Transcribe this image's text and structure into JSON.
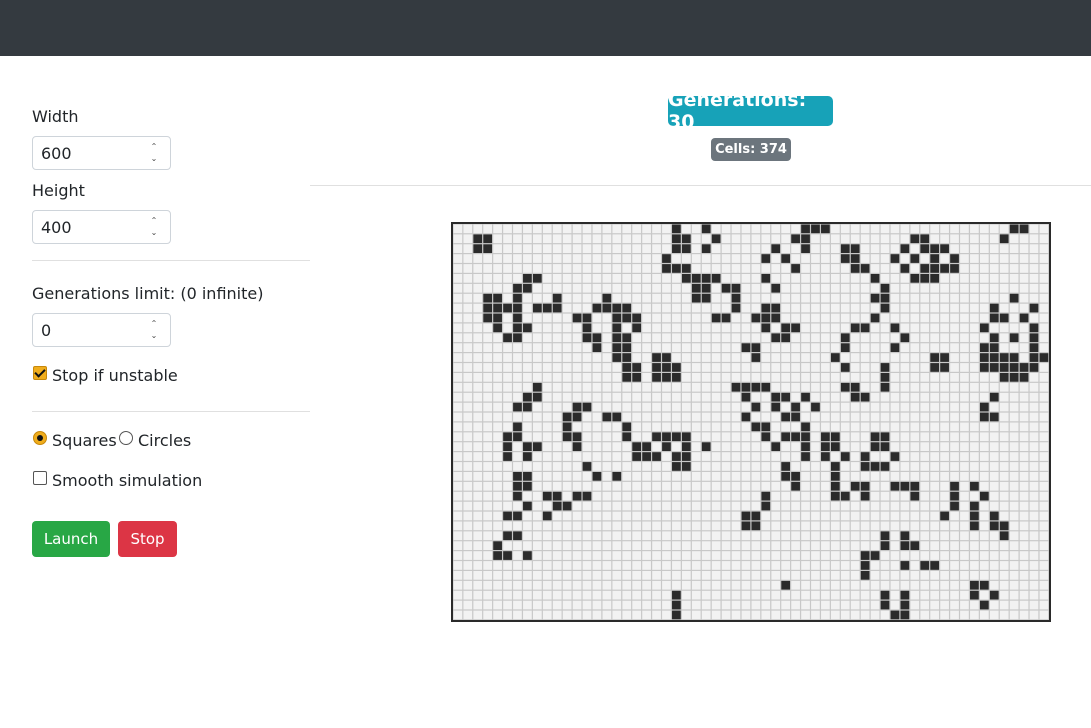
{
  "controls": {
    "width_label": "Width",
    "width_value": "600",
    "height_label": "Height",
    "height_value": "400",
    "gen_limit_label": "Generations limit: (0 infinite)",
    "gen_limit_value": "0",
    "stop_unstable_label": "Stop if unstable",
    "stop_unstable_checked": true,
    "shape_options": [
      "Squares",
      "Circles"
    ],
    "shape_selected": "Squares",
    "smooth_label": "Smooth simulation",
    "smooth_checked": false,
    "launch_label": "Launch",
    "stop_label": "Stop"
  },
  "stats": {
    "generations": "Generations: 30",
    "cells": "Cells: 374"
  },
  "colors": {
    "navbar": "#343a40",
    "launch": "#28a745",
    "stop": "#dc3545",
    "generations_badge": "#17a2b8",
    "cells_badge": "#6c757d",
    "accent": "#f0ad1c",
    "live_cell": "#2b2b2b",
    "dead_cell": "#f2f2f2"
  },
  "board": {
    "cols": 60,
    "rows": 40,
    "live_cells": [
      [
        0,
        22
      ],
      [
        0,
        25
      ],
      [
        0,
        35
      ],
      [
        0,
        36
      ],
      [
        0,
        37
      ],
      [
        0,
        56
      ],
      [
        0,
        57
      ],
      [
        1,
        2
      ],
      [
        1,
        3
      ],
      [
        1,
        22
      ],
      [
        1,
        23
      ],
      [
        1,
        26
      ],
      [
        1,
        34
      ],
      [
        1,
        35
      ],
      [
        1,
        46
      ],
      [
        1,
        47
      ],
      [
        1,
        55
      ],
      [
        2,
        2
      ],
      [
        2,
        3
      ],
      [
        2,
        22
      ],
      [
        2,
        23
      ],
      [
        2,
        25
      ],
      [
        2,
        32
      ],
      [
        2,
        35
      ],
      [
        2,
        39
      ],
      [
        2,
        40
      ],
      [
        2,
        45
      ],
      [
        2,
        47
      ],
      [
        2,
        48
      ],
      [
        2,
        49
      ],
      [
        3,
        21
      ],
      [
        3,
        31
      ],
      [
        3,
        33
      ],
      [
        3,
        39
      ],
      [
        3,
        40
      ],
      [
        3,
        44
      ],
      [
        3,
        46
      ],
      [
        3,
        48
      ],
      [
        3,
        50
      ],
      [
        4,
        21
      ],
      [
        4,
        22
      ],
      [
        4,
        23
      ],
      [
        4,
        34
      ],
      [
        4,
        40
      ],
      [
        4,
        41
      ],
      [
        4,
        45
      ],
      [
        4,
        47
      ],
      [
        4,
        48
      ],
      [
        4,
        49
      ],
      [
        4,
        50
      ],
      [
        5,
        7
      ],
      [
        5,
        8
      ],
      [
        5,
        23
      ],
      [
        5,
        24
      ],
      [
        5,
        25
      ],
      [
        5,
        26
      ],
      [
        5,
        31
      ],
      [
        5,
        42
      ],
      [
        5,
        46
      ],
      [
        5,
        47
      ],
      [
        5,
        48
      ],
      [
        6,
        6
      ],
      [
        6,
        7
      ],
      [
        6,
        24
      ],
      [
        6,
        25
      ],
      [
        6,
        27
      ],
      [
        6,
        28
      ],
      [
        6,
        32
      ],
      [
        6,
        43
      ],
      [
        7,
        3
      ],
      [
        7,
        4
      ],
      [
        7,
        6
      ],
      [
        7,
        10
      ],
      [
        7,
        15
      ],
      [
        7,
        24
      ],
      [
        7,
        25
      ],
      [
        7,
        28
      ],
      [
        7,
        42
      ],
      [
        7,
        43
      ],
      [
        7,
        56
      ],
      [
        8,
        3
      ],
      [
        8,
        4
      ],
      [
        8,
        5
      ],
      [
        8,
        6
      ],
      [
        8,
        8
      ],
      [
        8,
        9
      ],
      [
        8,
        10
      ],
      [
        8,
        14
      ],
      [
        8,
        15
      ],
      [
        8,
        16
      ],
      [
        8,
        17
      ],
      [
        8,
        28
      ],
      [
        8,
        31
      ],
      [
        8,
        32
      ],
      [
        8,
        43
      ],
      [
        8,
        54
      ],
      [
        8,
        58
      ],
      [
        9,
        3
      ],
      [
        9,
        4
      ],
      [
        9,
        6
      ],
      [
        9,
        12
      ],
      [
        9,
        13
      ],
      [
        9,
        16
      ],
      [
        9,
        17
      ],
      [
        9,
        18
      ],
      [
        9,
        26
      ],
      [
        9,
        27
      ],
      [
        9,
        30
      ],
      [
        9,
        31
      ],
      [
        9,
        32
      ],
      [
        9,
        42
      ],
      [
        9,
        54
      ],
      [
        9,
        55
      ],
      [
        9,
        57
      ],
      [
        10,
        4
      ],
      [
        10,
        6
      ],
      [
        10,
        7
      ],
      [
        10,
        13
      ],
      [
        10,
        16
      ],
      [
        10,
        18
      ],
      [
        10,
        31
      ],
      [
        10,
        33
      ],
      [
        10,
        34
      ],
      [
        10,
        40
      ],
      [
        10,
        41
      ],
      [
        10,
        44
      ],
      [
        10,
        53
      ],
      [
        10,
        58
      ],
      [
        11,
        5
      ],
      [
        11,
        6
      ],
      [
        11,
        13
      ],
      [
        11,
        14
      ],
      [
        11,
        16
      ],
      [
        11,
        17
      ],
      [
        11,
        32
      ],
      [
        11,
        33
      ],
      [
        11,
        39
      ],
      [
        11,
        45
      ],
      [
        11,
        54
      ],
      [
        11,
        56
      ],
      [
        11,
        58
      ],
      [
        12,
        14
      ],
      [
        12,
        16
      ],
      [
        12,
        17
      ],
      [
        12,
        29
      ],
      [
        12,
        30
      ],
      [
        12,
        39
      ],
      [
        12,
        44
      ],
      [
        12,
        53
      ],
      [
        12,
        54
      ],
      [
        12,
        58
      ],
      [
        13,
        16
      ],
      [
        13,
        17
      ],
      [
        13,
        20
      ],
      [
        13,
        21
      ],
      [
        13,
        30
      ],
      [
        13,
        38
      ],
      [
        13,
        48
      ],
      [
        13,
        49
      ],
      [
        13,
        53
      ],
      [
        13,
        54
      ],
      [
        13,
        55
      ],
      [
        13,
        56
      ],
      [
        13,
        58
      ],
      [
        13,
        59
      ],
      [
        14,
        17
      ],
      [
        14,
        18
      ],
      [
        14,
        20
      ],
      [
        14,
        21
      ],
      [
        14,
        22
      ],
      [
        14,
        39
      ],
      [
        14,
        43
      ],
      [
        14,
        48
      ],
      [
        14,
        49
      ],
      [
        14,
        53
      ],
      [
        14,
        54
      ],
      [
        14,
        55
      ],
      [
        14,
        56
      ],
      [
        14,
        57
      ],
      [
        14,
        58
      ],
      [
        15,
        17
      ],
      [
        15,
        18
      ],
      [
        15,
        20
      ],
      [
        15,
        21
      ],
      [
        15,
        22
      ],
      [
        15,
        43
      ],
      [
        15,
        55
      ],
      [
        15,
        56
      ],
      [
        15,
        57
      ],
      [
        16,
        8
      ],
      [
        16,
        28
      ],
      [
        16,
        29
      ],
      [
        16,
        30
      ],
      [
        16,
        31
      ],
      [
        16,
        39
      ],
      [
        16,
        40
      ],
      [
        16,
        43
      ],
      [
        17,
        7
      ],
      [
        17,
        8
      ],
      [
        17,
        29
      ],
      [
        17,
        32
      ],
      [
        17,
        33
      ],
      [
        17,
        35
      ],
      [
        17,
        40
      ],
      [
        17,
        41
      ],
      [
        17,
        54
      ],
      [
        18,
        6
      ],
      [
        18,
        7
      ],
      [
        18,
        12
      ],
      [
        18,
        13
      ],
      [
        18,
        30
      ],
      [
        18,
        32
      ],
      [
        18,
        34
      ],
      [
        18,
        36
      ],
      [
        18,
        53
      ],
      [
        19,
        11
      ],
      [
        19,
        12
      ],
      [
        19,
        15
      ],
      [
        19,
        16
      ],
      [
        19,
        29
      ],
      [
        19,
        33
      ],
      [
        19,
        34
      ],
      [
        19,
        53
      ],
      [
        19,
        54
      ],
      [
        20,
        6
      ],
      [
        20,
        11
      ],
      [
        20,
        17
      ],
      [
        20,
        30
      ],
      [
        20,
        31
      ],
      [
        20,
        35
      ],
      [
        21,
        5
      ],
      [
        21,
        6
      ],
      [
        21,
        11
      ],
      [
        21,
        12
      ],
      [
        21,
        17
      ],
      [
        21,
        20
      ],
      [
        21,
        21
      ],
      [
        21,
        22
      ],
      [
        21,
        23
      ],
      [
        21,
        31
      ],
      [
        21,
        33
      ],
      [
        21,
        34
      ],
      [
        21,
        35
      ],
      [
        21,
        37
      ],
      [
        21,
        38
      ],
      [
        21,
        42
      ],
      [
        21,
        43
      ],
      [
        22,
        5
      ],
      [
        22,
        7
      ],
      [
        22,
        8
      ],
      [
        22,
        12
      ],
      [
        22,
        18
      ],
      [
        22,
        19
      ],
      [
        22,
        21
      ],
      [
        22,
        23
      ],
      [
        22,
        25
      ],
      [
        22,
        32
      ],
      [
        22,
        35
      ],
      [
        22,
        37
      ],
      [
        22,
        38
      ],
      [
        22,
        42
      ],
      [
        22,
        43
      ],
      [
        23,
        5
      ],
      [
        23,
        7
      ],
      [
        23,
        18
      ],
      [
        23,
        19
      ],
      [
        23,
        20
      ],
      [
        23,
        22
      ],
      [
        23,
        23
      ],
      [
        23,
        35
      ],
      [
        23,
        37
      ],
      [
        23,
        39
      ],
      [
        23,
        41
      ],
      [
        23,
        44
      ],
      [
        24,
        13
      ],
      [
        24,
        22
      ],
      [
        24,
        23
      ],
      [
        24,
        33
      ],
      [
        24,
        38
      ],
      [
        24,
        41
      ],
      [
        24,
        42
      ],
      [
        24,
        43
      ],
      [
        25,
        6
      ],
      [
        25,
        7
      ],
      [
        25,
        14
      ],
      [
        25,
        16
      ],
      [
        25,
        33
      ],
      [
        25,
        34
      ],
      [
        25,
        38
      ],
      [
        26,
        6
      ],
      [
        26,
        7
      ],
      [
        26,
        34
      ],
      [
        26,
        38
      ],
      [
        26,
        40
      ],
      [
        26,
        41
      ],
      [
        26,
        44
      ],
      [
        26,
        45
      ],
      [
        26,
        46
      ],
      [
        26,
        50
      ],
      [
        26,
        52
      ],
      [
        27,
        6
      ],
      [
        27,
        9
      ],
      [
        27,
        10
      ],
      [
        27,
        12
      ],
      [
        27,
        13
      ],
      [
        27,
        31
      ],
      [
        27,
        38
      ],
      [
        27,
        39
      ],
      [
        27,
        41
      ],
      [
        27,
        46
      ],
      [
        27,
        50
      ],
      [
        27,
        53
      ],
      [
        28,
        7
      ],
      [
        28,
        10
      ],
      [
        28,
        11
      ],
      [
        28,
        31
      ],
      [
        28,
        50
      ],
      [
        28,
        52
      ],
      [
        29,
        5
      ],
      [
        29,
        6
      ],
      [
        29,
        9
      ],
      [
        29,
        29
      ],
      [
        29,
        30
      ],
      [
        29,
        49
      ],
      [
        29,
        52
      ],
      [
        29,
        54
      ],
      [
        30,
        29
      ],
      [
        30,
        30
      ],
      [
        30,
        52
      ],
      [
        30,
        54
      ],
      [
        30,
        55
      ],
      [
        31,
        5
      ],
      [
        31,
        6
      ],
      [
        31,
        43
      ],
      [
        31,
        45
      ],
      [
        31,
        55
      ],
      [
        32,
        4
      ],
      [
        32,
        43
      ],
      [
        32,
        45
      ],
      [
        32,
        46
      ],
      [
        33,
        4
      ],
      [
        33,
        5
      ],
      [
        33,
        7
      ],
      [
        33,
        41
      ],
      [
        33,
        42
      ],
      [
        34,
        41
      ],
      [
        34,
        45
      ],
      [
        34,
        47
      ],
      [
        34,
        48
      ],
      [
        35,
        41
      ],
      [
        36,
        33
      ],
      [
        36,
        52
      ],
      [
        36,
        53
      ],
      [
        37,
        22
      ],
      [
        37,
        43
      ],
      [
        37,
        45
      ],
      [
        37,
        52
      ],
      [
        37,
        54
      ],
      [
        38,
        22
      ],
      [
        38,
        43
      ],
      [
        38,
        45
      ],
      [
        38,
        53
      ],
      [
        39,
        22
      ],
      [
        39,
        44
      ],
      [
        39,
        45
      ]
    ]
  }
}
